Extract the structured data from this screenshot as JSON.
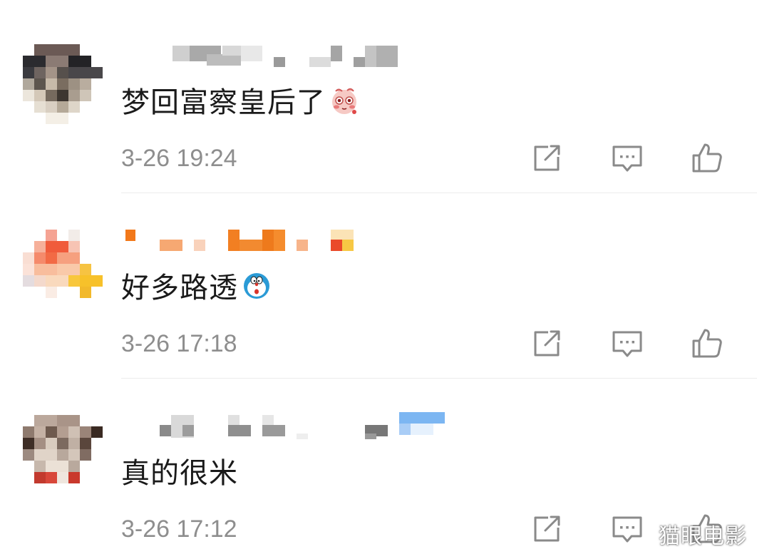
{
  "comments": [
    {
      "text": "梦回富察皇后了",
      "timestamp": "3-26 19:24",
      "emoji": "shy-face-emoji"
    },
    {
      "text": "好多路透",
      "timestamp": "3-26 17:18",
      "emoji": "doraemon-emoji"
    },
    {
      "text": "真的很米",
      "timestamp": "3-26 17:12",
      "emoji": ""
    }
  ],
  "actions": {
    "share_icon": "share-icon",
    "comment_icon": "comment-icon",
    "like_icon": "like-icon"
  },
  "watermark": "猫眼电影",
  "colors": {
    "timestamp": "#8e8e8e",
    "icon_stroke": "#8a8a8a",
    "divider": "#ececec",
    "text": "#1a1a1a"
  }
}
